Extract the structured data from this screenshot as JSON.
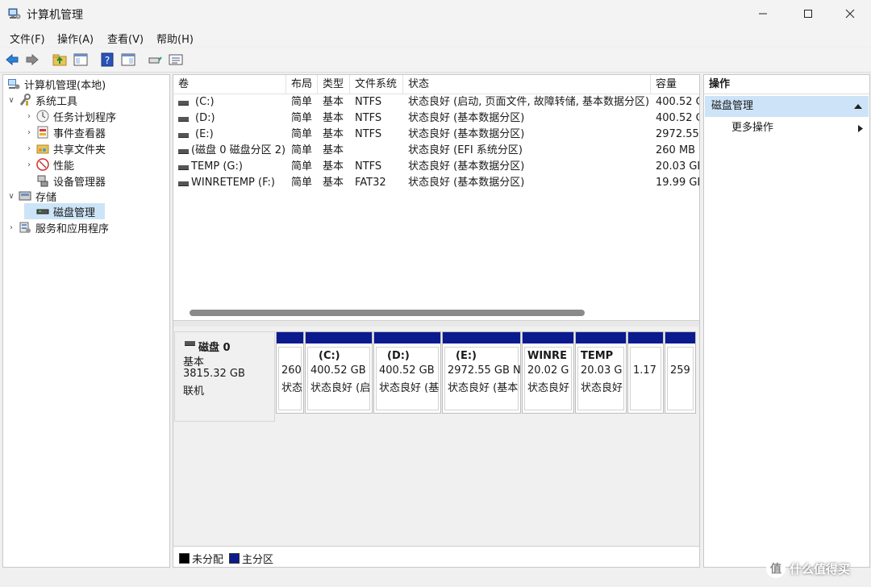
{
  "title_bar": {
    "title": "计算机管理"
  },
  "menu": [
    "文件(F)",
    "操作(A)",
    "查看(V)",
    "帮助(H)"
  ],
  "tree": [
    {
      "label": "计算机管理(本地)",
      "level": 0,
      "chevron": "",
      "icon": "computer-management-icon"
    },
    {
      "label": "系统工具",
      "level": 1,
      "chevron": "∨",
      "icon": "system-tools-icon"
    },
    {
      "label": "任务计划程序",
      "level": 2,
      "chevron": "›",
      "icon": "task-scheduler-icon"
    },
    {
      "label": "事件查看器",
      "level": 2,
      "chevron": "›",
      "icon": "event-viewer-icon"
    },
    {
      "label": "共享文件夹",
      "level": 2,
      "chevron": "›",
      "icon": "shared-folders-icon"
    },
    {
      "label": "性能",
      "level": 2,
      "chevron": "›",
      "icon": "performance-icon"
    },
    {
      "label": "设备管理器",
      "level": 2,
      "chevron": "",
      "icon": "device-manager-icon"
    },
    {
      "label": "存储",
      "level": 1,
      "chevron": "∨",
      "icon": "storage-icon"
    },
    {
      "label": "磁盘管理",
      "level": 2,
      "chevron": "",
      "icon": "disk-management-icon",
      "selected": true
    },
    {
      "label": "服务和应用程序",
      "level": 1,
      "chevron": "›",
      "icon": "services-apps-icon"
    }
  ],
  "volume_list": {
    "columns": [
      "卷",
      "布局",
      "类型",
      "文件系统",
      "状态",
      "容量"
    ],
    "rows": [
      [
        "(C:)",
        "简单",
        "基本",
        "NTFS",
        "状态良好 (启动, 页面文件, 故障转储, 基本数据分区)",
        "400.52 G"
      ],
      [
        "(D:)",
        "简单",
        "基本",
        "NTFS",
        "状态良好 (基本数据分区)",
        "400.52 G"
      ],
      [
        "(E:)",
        "简单",
        "基本",
        "NTFS",
        "状态良好 (基本数据分区)",
        "2972.55"
      ],
      [
        "(磁盘 0 磁盘分区 2)",
        "简单",
        "基本",
        "",
        "状态良好 (EFI 系统分区)",
        "260 MB"
      ],
      [
        "TEMP (G:)",
        "简单",
        "基本",
        "NTFS",
        "状态良好 (基本数据分区)",
        "20.03 GE"
      ],
      [
        "WINRETEMP (F:)",
        "简单",
        "基本",
        "FAT32",
        "状态良好 (基本数据分区)",
        "19.99 GE"
      ]
    ]
  },
  "disk": {
    "name": "磁盘 0",
    "type": "基本",
    "size": "3815.32 GB",
    "status": "联机",
    "partitions": [
      {
        "name": "",
        "size": "260",
        "status": "状态"
      },
      {
        "name": "(C:)",
        "size": "400.52 GB",
        "status": "状态良好 (启"
      },
      {
        "name": "(D:)",
        "size": "400.52 GB",
        "status": "状态良好 (基"
      },
      {
        "name": "(E:)",
        "size": "2972.55 GB N",
        "status": "状态良好 (基本"
      },
      {
        "name": "WINRE",
        "size": "20.02 G",
        "status": "状态良好"
      },
      {
        "name": "TEMP",
        "size": "20.03 G",
        "status": "状态良好"
      },
      {
        "name": "",
        "size": "1.17",
        "status": ""
      },
      {
        "name": "",
        "size": "259",
        "status": ""
      }
    ]
  },
  "legend": [
    {
      "label": "未分配",
      "color": "#000000"
    },
    {
      "label": "主分区",
      "color": "#0b1a8e"
    }
  ],
  "actions": {
    "title": "操作",
    "section": "磁盘管理",
    "more": "更多操作"
  },
  "watermark": {
    "text": "什么值得买",
    "glyph": "值"
  }
}
